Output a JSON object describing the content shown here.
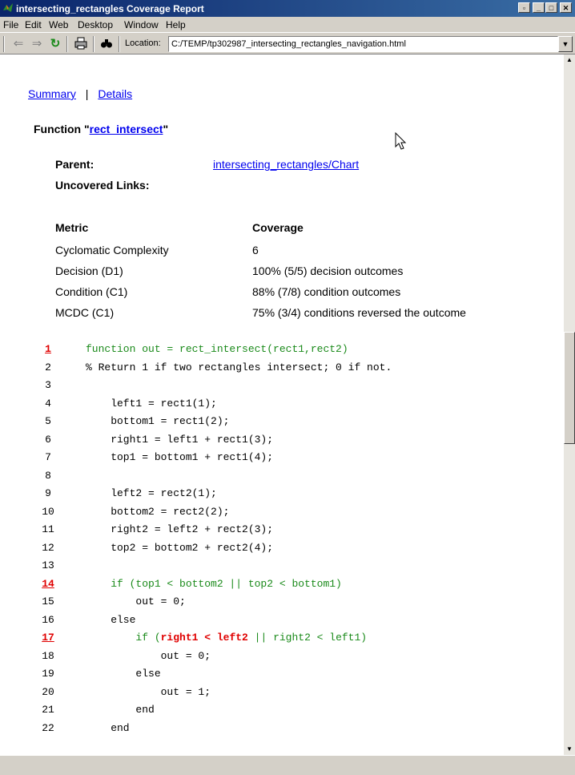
{
  "window": {
    "title": "intersecting_rectangles Coverage Report",
    "buttons": [
      "▫",
      "_",
      "□",
      "✕"
    ]
  },
  "menu": [
    "File",
    "Edit",
    "Web",
    "Desktop",
    "Window",
    "Help"
  ],
  "toolbar": {
    "location_label": "Location:",
    "location_value": "C:/TEMP/tp302987_intersecting_rectangles_navigation.html",
    "icons": [
      "back-arrow-icon",
      "forward-arrow-icon",
      "refresh-icon",
      "print-icon",
      "find-icon"
    ]
  },
  "nav": {
    "summary": "Summary",
    "separator": "|",
    "details": "Details"
  },
  "function": {
    "prefix": "Function \"",
    "name": "rect_intersect",
    "suffix": "\""
  },
  "info": {
    "parent_label": "Parent:",
    "parent_link": "intersecting_rectangles/Chart",
    "uncovered_label": "Uncovered Links:"
  },
  "metrics": {
    "header_metric": "Metric",
    "header_coverage": "Coverage",
    "rows": [
      {
        "metric": "Cyclomatic Complexity",
        "coverage": "6"
      },
      {
        "metric": "Decision (D1)",
        "coverage": "100% (5/5) decision outcomes"
      },
      {
        "metric": "Condition (C1)",
        "coverage": "88% (7/8) condition outcomes"
      },
      {
        "metric": "MCDC (C1)",
        "coverage": "75% (3/4) conditions reversed the outcome"
      }
    ]
  },
  "code": [
    {
      "n": "1",
      "text": "function out = rect_intersect(rect1,rect2)",
      "hl": true,
      "cov": true
    },
    {
      "n": "2",
      "text": "% Return 1 if two rectangles intersect; 0 if not."
    },
    {
      "n": "3",
      "text": ""
    },
    {
      "n": "4",
      "text": "    left1 = rect1(1);"
    },
    {
      "n": "5",
      "text": "    bottom1 = rect1(2);"
    },
    {
      "n": "6",
      "text": "    right1 = left1 + rect1(3);"
    },
    {
      "n": "7",
      "text": "    top1 = bottom1 + rect1(4);"
    },
    {
      "n": "8",
      "text": ""
    },
    {
      "n": "9",
      "text": "    left2 = rect2(1);"
    },
    {
      "n": "10",
      "text": "    bottom2 = rect2(2);"
    },
    {
      "n": "11",
      "text": "    right2 = left2 + rect2(3);"
    },
    {
      "n": "12",
      "text": "    top2 = bottom2 + rect2(4);"
    },
    {
      "n": "13",
      "text": ""
    },
    {
      "n": "14",
      "text": "    if (top1 < bottom2 || top2 < bottom1)",
      "hl": true,
      "cov": true
    },
    {
      "n": "15",
      "text": "        out = 0;"
    },
    {
      "n": "16",
      "text": "    else"
    },
    {
      "n": "17",
      "parts": [
        {
          "t": "        if (",
          "c": "cov"
        },
        {
          "t": "right1",
          "c": "red"
        },
        {
          "t": " < ",
          "c": "red"
        },
        {
          "t": "left2",
          "c": "red"
        },
        {
          "t": " || right2 < left1)",
          "c": "cov"
        }
      ],
      "hl": true
    },
    {
      "n": "18",
      "text": "            out = 0;"
    },
    {
      "n": "19",
      "text": "        else"
    },
    {
      "n": "20",
      "text": "            out = 1;"
    },
    {
      "n": "21",
      "text": "        end"
    },
    {
      "n": "22",
      "text": "    end"
    }
  ]
}
